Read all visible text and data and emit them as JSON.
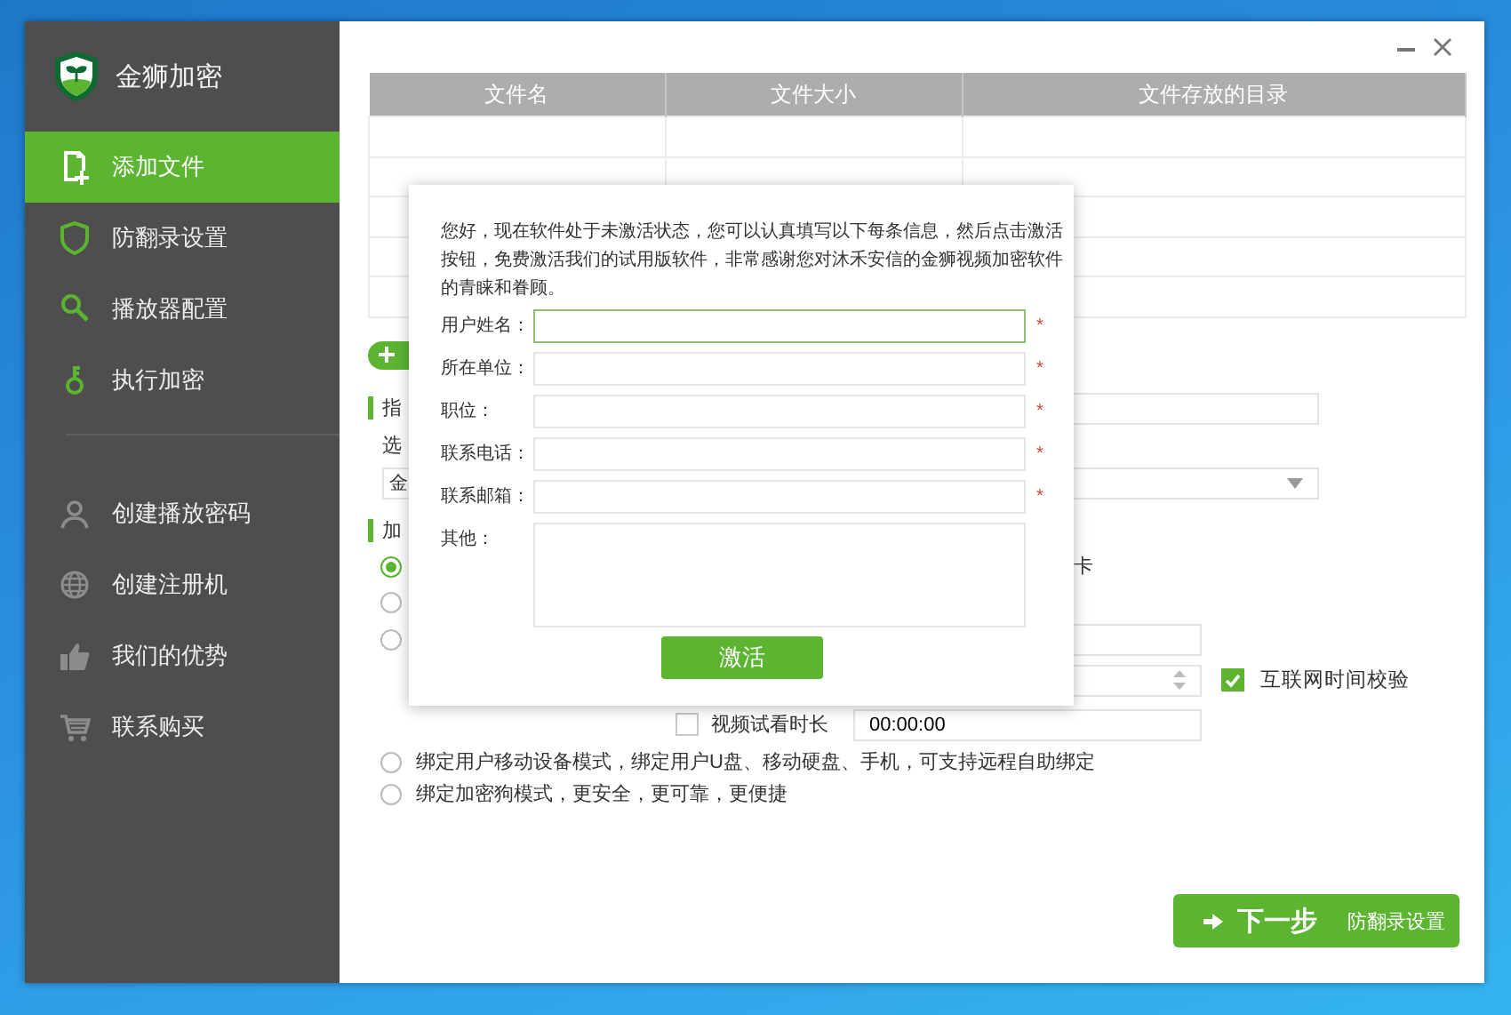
{
  "app": {
    "title": "金狮加密"
  },
  "sidebar": {
    "items": [
      {
        "label": "添加文件",
        "selected": true
      },
      {
        "label": "防翻录设置",
        "selected": false
      },
      {
        "label": "播放器配置",
        "selected": false
      },
      {
        "label": "执行加密",
        "selected": false
      }
    ],
    "tools": [
      {
        "label": "创建播放密码"
      },
      {
        "label": "创建注册机"
      },
      {
        "label": "我们的优势"
      },
      {
        "label": "联系购买"
      }
    ]
  },
  "table": {
    "columns": [
      "文件名",
      "文件大小",
      "文件存放的目录"
    ]
  },
  "settings": {
    "section_1": "指",
    "label_1": "选",
    "select_value": "金",
    "section_2": "加",
    "radios": [
      {
        "label": "卡",
        "selected": true
      },
      {
        "selected": false
      },
      {
        "selected": false
      },
      {
        "label": "绑定用户移动设备模式，绑定用户U盘、移动硬盘、手机，可支持远程自助绑定",
        "selected": false
      },
      {
        "label": "绑定加密狗模式，更安全，更可靠，更便捷",
        "selected": false
      }
    ],
    "internet_time": {
      "label": "互联网时间校验",
      "checked": true
    },
    "trial": {
      "label": "视频试看时长",
      "checked": false,
      "value": "00:00:00"
    }
  },
  "dialog": {
    "message": "您好，现在软件处于未激活状态，您可以认真填写以下每条信息，然后点击激活按钮，免费激活我们的试用版软件，非常感谢您对沐禾安信的金狮视频加密软件的青睐和眷顾。",
    "fields": [
      {
        "label": "用户姓名：",
        "required_mark": "*",
        "focused": true
      },
      {
        "label": "所在单位：",
        "required_mark": "*",
        "focused": false
      },
      {
        "label": "职位：",
        "required_mark": "*",
        "focused": false
      },
      {
        "label": "联系电话：",
        "required_mark": "*",
        "focused": false
      },
      {
        "label": "联系邮箱：",
        "required_mark": "*",
        "focused": false
      },
      {
        "label": "其他：",
        "kind": "textarea",
        "focused": false
      }
    ],
    "button": "激活"
  },
  "next_button": {
    "label": "下一步",
    "subtitle": "防翻录设置"
  }
}
